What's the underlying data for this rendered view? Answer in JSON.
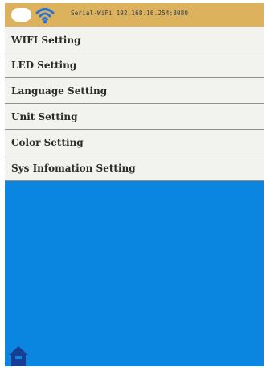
{
  "status_bar": {
    "text": "Serial-WiFi 192.168.16.254:8080"
  },
  "menu": {
    "items": [
      {
        "label": "WIFI Setting"
      },
      {
        "label": "LED Setting"
      },
      {
        "label": "Language Setting"
      },
      {
        "label": "Unit Setting"
      },
      {
        "label": "Color Setting"
      },
      {
        "label": "Sys Infomation  Setting"
      }
    ]
  },
  "icons": {
    "status": "wifi-icon",
    "home": "home-icon"
  },
  "colors": {
    "status_bar": "#ddb25c",
    "menu_background": "#f2f2ee",
    "main_background": "#0a86e0",
    "home_icon": "#163f93"
  }
}
